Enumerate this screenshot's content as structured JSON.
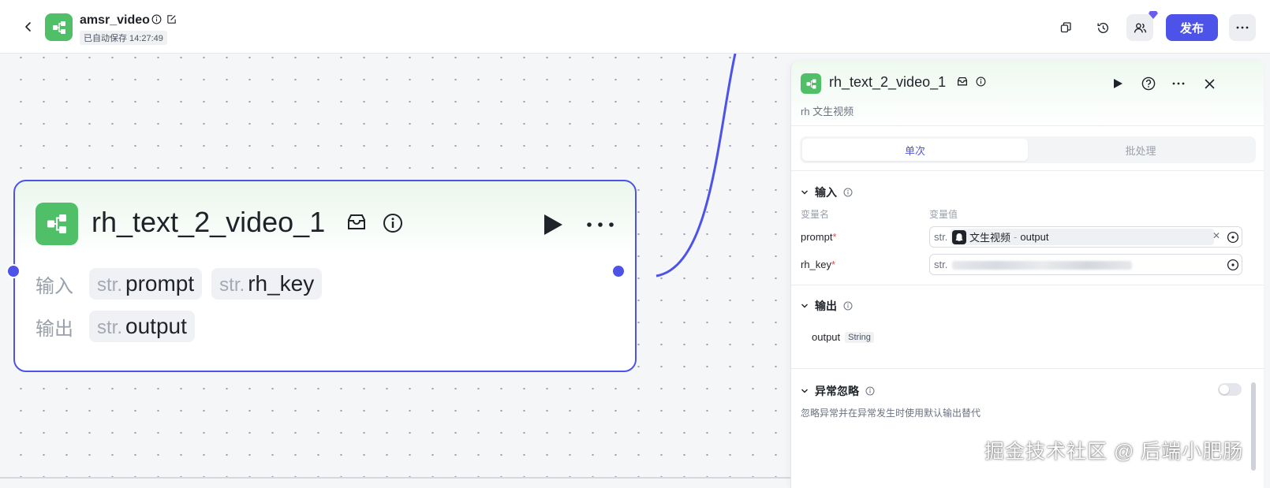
{
  "header": {
    "app_title": "amsr_video",
    "autosave": "已自动保存 14:27:49",
    "publish_label": "发布"
  },
  "node": {
    "title": "rh_text_2_video_1",
    "input_label": "输入",
    "output_label": "输出",
    "inputs": [
      {
        "type": "str.",
        "name": "prompt"
      },
      {
        "type": "str.",
        "name": "rh_key"
      }
    ],
    "outputs": [
      {
        "type": "str.",
        "name": "output"
      }
    ]
  },
  "panel": {
    "title": "rh_text_2_video_1",
    "subtitle": "rh 文生视频",
    "tabs": [
      {
        "label": "单次",
        "active": true
      },
      {
        "label": "批处理",
        "active": false
      }
    ],
    "input_section": {
      "title": "输入",
      "col_name": "变量名",
      "col_value": "变量值",
      "vars": [
        {
          "name": "prompt",
          "required_mark": "*",
          "type": "str.",
          "ref_node": "文生视频",
          "ref_sep": " - ",
          "ref_field": "output"
        },
        {
          "name": "rh_key",
          "required_mark": "*",
          "type": "str.",
          "masked": true
        }
      ]
    },
    "output_section": {
      "title": "输出",
      "outputs": [
        {
          "name": "output",
          "type": "String"
        }
      ]
    },
    "error_section": {
      "title": "异常忽略",
      "description": "忽略异常并在异常发生时使用默认输出替代",
      "enabled": false
    }
  },
  "watermark": "掘金技术社区 @ 后端小肥肠",
  "colors": {
    "accent": "#4d53e8",
    "node_green": "#4fbf68",
    "required": "#e5484d"
  }
}
